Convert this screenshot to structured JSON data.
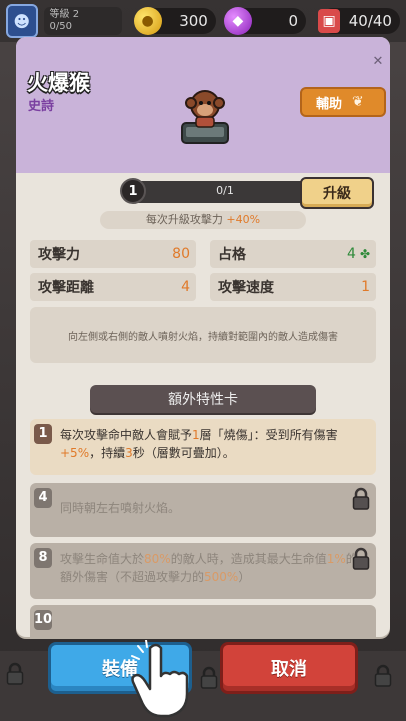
{
  "topbar": {
    "level_label": "等級 2",
    "level_progress": "0/50",
    "coins": "300",
    "gems": "0",
    "energy": "40/40"
  },
  "monster": {
    "name": "火爆猴",
    "rarity": "史詩",
    "role": "輔助"
  },
  "upgrade": {
    "level": "1",
    "progress_text": "0/1",
    "progress_fraction": 0,
    "button_label": "升級",
    "info_prefix": "每次升級攻擊力 ",
    "info_value": "+40%"
  },
  "stats": [
    {
      "label": "攻擊力",
      "value": "80"
    },
    {
      "label": "占格",
      "value": "4"
    },
    {
      "label": "攻擊距離",
      "value": "4"
    },
    {
      "label": "攻擊速度",
      "value": "1"
    }
  ],
  "description": "向左側或右側的敵人噴射火焰，持續對範圍內的敵人造成傷害",
  "traits": {
    "title": "額外特性卡",
    "cards": [
      {
        "num": "1",
        "t1": "每次攻擊命中敵人會賦予",
        "h1": "1",
        "t2": "層「燒傷」：受到所有傷害",
        "h2": "+5%",
        "t3": "，持續",
        "h3": "3",
        "t4": "秒（層數可疊加）。",
        "locked": false
      },
      {
        "num": "4",
        "text": "同時朝左右噴射火焰。",
        "locked": true
      },
      {
        "num": "8",
        "t1": "攻擊生命值大於",
        "h1": "80%",
        "t2": "的敵人時，造成其最大生命值",
        "h2": "1%",
        "t3": "的額外傷害（不超過攻擊力的",
        "h3": "500%",
        "t4": "）",
        "locked": true
      },
      {
        "num": "10",
        "locked": true
      }
    ]
  },
  "buttons": {
    "equip": "裝備",
    "cancel": "取消"
  }
}
